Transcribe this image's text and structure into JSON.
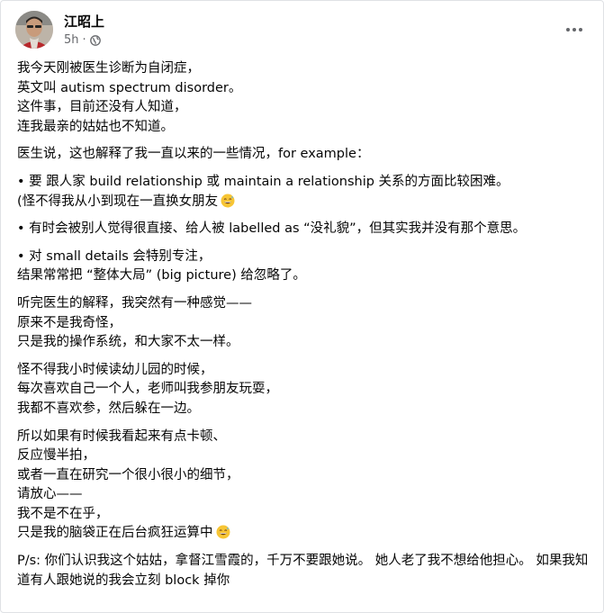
{
  "post": {
    "author": "江昭上",
    "time": "5h",
    "separator": "·",
    "privacy_icon": "globe-icon",
    "menu_icon": "more-options-icon",
    "paragraphs": [
      [
        "我今天刚被医生诊断为自闭症，",
        "英文叫 autism spectrum disorder。",
        "这件事，目前还没有人知道，",
        "连我最亲的姑姑也不知道。"
      ],
      [
        "医生说，这也解释了我一直以来的一些情况，for example："
      ],
      [
        "• 要 跟人家 build relationship 或 maintain a relationship 关系的方面比较困难。",
        "(怪不得我从小到现在一直换女朋友"
      ],
      [
        "• 有时会被别人觉得很直接、给人被 labelled as “没礼貌”，但其实我并没有那个意思。"
      ],
      [
        "• 对 small details 会特别专注，",
        "结果常常把 “整体大局” (big picture) 给忽略了。"
      ],
      [
        "听完医生的解释，我突然有一种感觉——",
        "原来不是我奇怪，",
        "只是我的操作系统，和大家不太一样。"
      ],
      [
        "怪不得我小时候读幼儿园的时候，",
        "每次喜欢自己一个人，老师叫我参朋友玩耍，",
        "我都不喜欢参，然后躲在一边。"
      ],
      [
        "所以如果有时候我看起来有点卡顿、",
        "反应慢半拍，",
        "或者一直在研究一个很小很小的细节，",
        "请放心——",
        "我不是不在乎，",
        "只是我的脑袋正在后台疯狂运算中"
      ],
      [
        "P/s: 你们认识我这个姑姑，拿督江雪霞的，千万不要跟她说。 她人老了我不想给他担心。 如果我知道有人跟她说的我会立刻 block 掉你"
      ]
    ],
    "emoji_icon": "grinning-sweat-emoji"
  }
}
